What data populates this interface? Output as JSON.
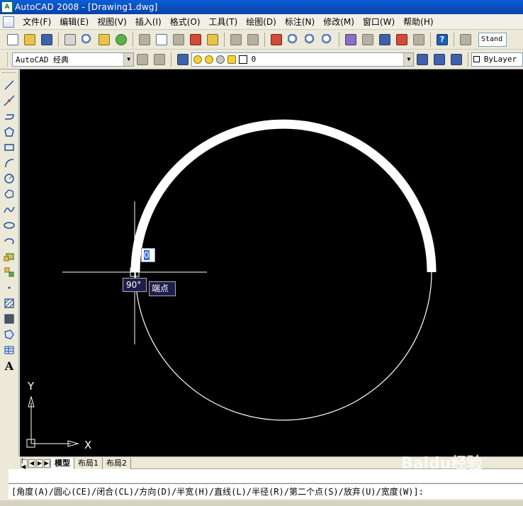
{
  "window": {
    "title": "AutoCAD 2008 - [Drawing1.dwg]"
  },
  "menu": {
    "items": [
      "文件(F)",
      "编辑(E)",
      "视图(V)",
      "插入(I)",
      "格式(O)",
      "工具(T)",
      "绘图(D)",
      "标注(N)",
      "修改(M)",
      "窗口(W)",
      "帮助(H)"
    ]
  },
  "toolbar": {
    "text_style": "Stand"
  },
  "workspace": {
    "value": "AutoCAD 经典"
  },
  "layer": {
    "value": "0"
  },
  "color": {
    "value": "ByLayer"
  },
  "draw_toolbar": {
    "text_tool_label": "A"
  },
  "drawing": {
    "dynamic_input_value": "0",
    "angle_tooltip": "90°",
    "snap_tooltip": "端点",
    "ucs_x_label": "X",
    "ucs_y_label": "Y"
  },
  "layout_tabs": [
    "模型",
    "布局1",
    "布局2"
  ],
  "command_line": {
    "prompt": "[角度(A)/圆心(CE)/闭合(CL)/方向(D)/半宽(H)/直线(L)/半径(R)/第二个点(S)/放弃(U)/宽度(W)]:"
  },
  "watermark": {
    "text": "Baidu经验"
  },
  "colors": {
    "canvas": "#000000",
    "titlebar": "#0a5fd8",
    "polyline": "#ffffff"
  }
}
